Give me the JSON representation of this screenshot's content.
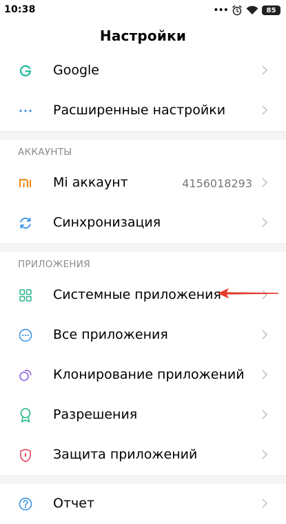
{
  "status_bar": {
    "time": "10:38",
    "dots": "•••",
    "battery": "85"
  },
  "header": {
    "title": "Настройки"
  },
  "groups": [
    {
      "items": [
        {
          "id": "google",
          "label": "Google",
          "icon": "google-icon"
        },
        {
          "id": "advanced",
          "label": "Расширенные настройки",
          "icon": "more-dots-icon"
        }
      ]
    },
    {
      "section": "АККАУНТЫ",
      "items": [
        {
          "id": "mi-account",
          "label": "Mi аккаунт",
          "value": "4156018293",
          "icon": "mi-logo-icon"
        },
        {
          "id": "sync",
          "label": "Синхронизация",
          "icon": "sync-icon"
        }
      ]
    },
    {
      "section": "ПРИЛОЖЕНИЯ",
      "items": [
        {
          "id": "system-apps",
          "label": "Системные приложения",
          "icon": "grid-icon"
        },
        {
          "id": "all-apps",
          "label": "Все приложения",
          "icon": "apps-dots-icon"
        },
        {
          "id": "clone-apps",
          "label": "Клонирование приложений",
          "icon": "clone-icon"
        },
        {
          "id": "permissions",
          "label": "Разрешения",
          "icon": "badge-icon"
        },
        {
          "id": "app-protection",
          "label": "Защита приложений",
          "icon": "shield-icon"
        }
      ]
    },
    {
      "items": [
        {
          "id": "feedback",
          "label": "Отчет",
          "icon": "help-icon"
        }
      ]
    }
  ],
  "colors": {
    "google": "#1fb89b",
    "dots": "#3a8fe0",
    "mi": "#f08a1c",
    "sync": "#2d8fe3",
    "grid": "#2bb38d",
    "apps": "#2d8fe3",
    "clone": "#8b5fe0",
    "badge": "#1fb88a",
    "shield": "#e0455a",
    "help": "#2d8fe3",
    "annotation_arrow": "#e33a2c"
  }
}
